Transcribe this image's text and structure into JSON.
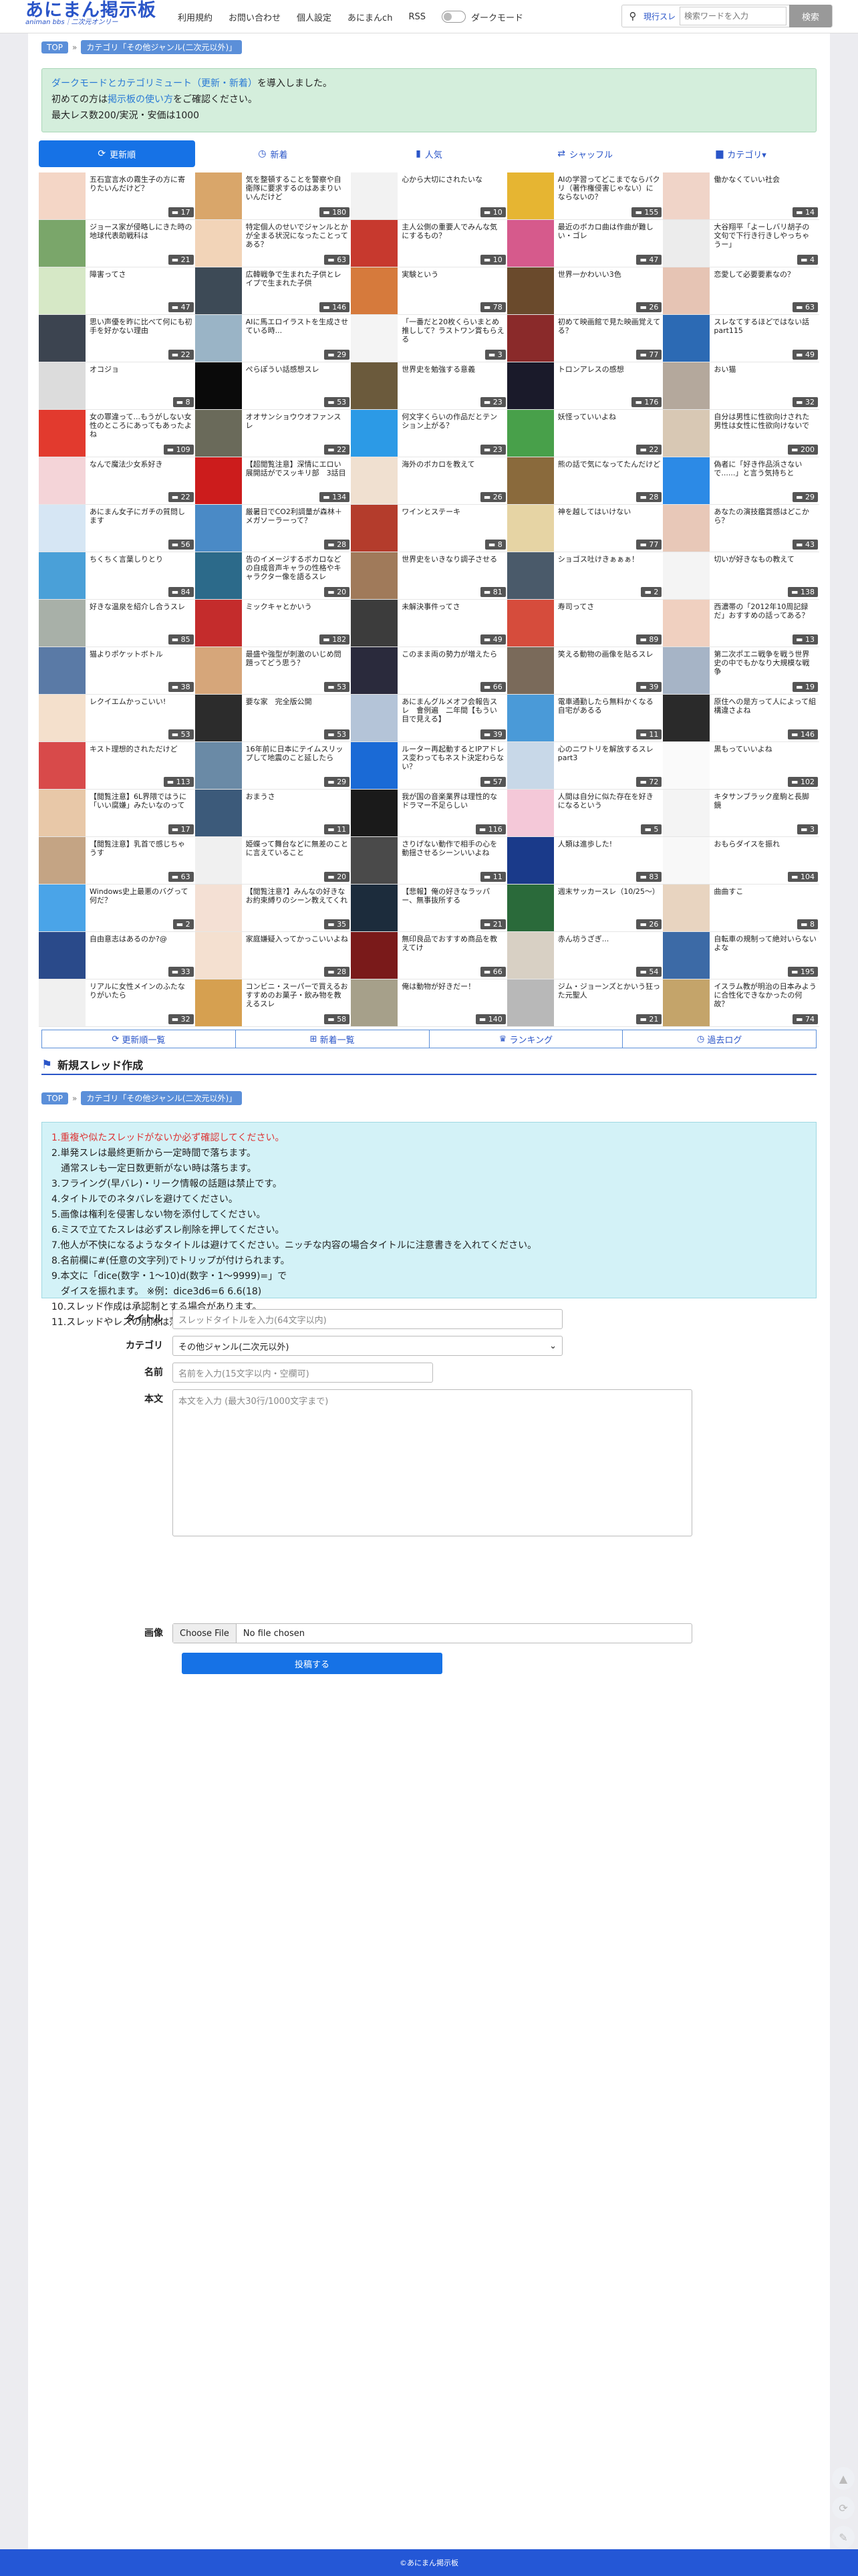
{
  "header": {
    "logo_title": "あにまん掲示板",
    "logo_sub": "animan bbs｜二次元オンリー",
    "nav": [
      "利用規約",
      "お問い合わせ",
      "個人設定",
      "あにまんch",
      "RSS"
    ],
    "dark_mode_label": "ダークモード",
    "search": {
      "scope": "現行スレ",
      "placeholder": "検索ワードを入力",
      "button": "検索"
    }
  },
  "breadcrumb": {
    "top": "TOP",
    "category": "カテゴリ「その他ジャンル(二次元以外)」"
  },
  "notice": {
    "line1_link": "ダークモードとカテゴリミュート（更新・新着）",
    "line1_rest": "を導入しました。",
    "line2_pre": "初めての方は",
    "line2_link": "掲示板の使い方",
    "line2_post": "をご確認ください。",
    "line3": "最大レス数200/実況・安価は1000"
  },
  "tabs": [
    {
      "icon": "refresh-icon",
      "glyph": "⟳",
      "label": "更新順",
      "active": true
    },
    {
      "icon": "clock-icon",
      "glyph": "◷",
      "label": "新着",
      "active": false
    },
    {
      "icon": "bar-chart-icon",
      "glyph": "▮",
      "label": "人気",
      "active": false
    },
    {
      "icon": "shuffle-icon",
      "glyph": "⇄",
      "label": "シャッフル",
      "active": false
    },
    {
      "icon": "folder-icon",
      "glyph": "▆",
      "label": "カテゴリ▾",
      "active": false
    }
  ],
  "threads": [
    {
      "t": "五石宣言水の霧生子の方に寄りたいんだけど？",
      "c": "17",
      "bg": "#f4d6c6"
    },
    {
      "t": "気を整頓することを警察や自衛隊に要求するのはあまりいいんだけど",
      "c": "180",
      "bg": "#d9a66a"
    },
    {
      "t": "心から大切にされたいな",
      "c": "10",
      "bg": "#f2f2f2"
    },
    {
      "t": "AIの学習ってどこまでならパクリ（著作権侵害じゃない）にならないの？",
      "c": "155",
      "bg": "#e6b532"
    },
    {
      "t": "働かなくていい社会",
      "c": "14",
      "bg": "#f0d4c8"
    },
    {
      "t": "ジョース家が侵略しにきた時の地球代表助戦科は",
      "c": "21",
      "bg": "#7aa66a"
    },
    {
      "t": "特定個人のせいでジャンルとかが全まる状況になったことってある？",
      "c": "63",
      "bg": "#f2d4b8"
    },
    {
      "t": "主人公側の重要人でみんな気にするもの？",
      "c": "10",
      "bg": "#c7392e"
    },
    {
      "t": "最近のボカロ曲は作曲が難しい・ゴレ",
      "c": "47",
      "bg": "#d65a8c"
    },
    {
      "t": "大谷翔平「よーしバリ胡子の文句で下行き行きしやっちゃうー」",
      "c": "4",
      "bg": "#ececec"
    },
    {
      "t": "障害ってさ",
      "c": "47",
      "bg": "#d6e8c6"
    },
    {
      "t": "広韓戦争で生まれた子供とレイプで生まれた子供",
      "c": "146",
      "bg": "#3d4a56"
    },
    {
      "t": "実験という",
      "c": "78",
      "bg": "#d67a3c"
    },
    {
      "t": "世界一かわいい3色",
      "c": "26",
      "bg": "#6a4a2c"
    },
    {
      "t": "恋愛して必要要素なの？",
      "c": "63",
      "bg": "#e6c4b4"
    },
    {
      "t": "思い声優を昨に比べて何にも初手を好かない理由",
      "c": "22",
      "bg": "#3c4450"
    },
    {
      "t": "AIに馬エロイラストを生成させている時...",
      "c": "29",
      "bg": "#9ab4c6"
    },
    {
      "t": "「一番だと20枚くらいまとめ推しして？ラストワン賞もらえる",
      "c": "3",
      "bg": "#f4f4f4"
    },
    {
      "t": "初めて映画館で見た映画覚えてる？",
      "c": "77",
      "bg": "#8a2a2a"
    },
    {
      "t": "スレなてするほどではない話 part115",
      "c": "49",
      "bg": "#2c6ab4"
    },
    {
      "t": "オコジョ",
      "c": "8",
      "bg": "#dcdcdc"
    },
    {
      "t": "ぺらぽうい話感想スレ",
      "c": "53",
      "bg": "#0a0a0a"
    },
    {
      "t": "世界史を勉強する意義",
      "c": "23",
      "bg": "#6b5a3c"
    },
    {
      "t": "トロンアレスの感想",
      "c": "176",
      "bg": "#1a1a2a"
    },
    {
      "t": "おい猫",
      "c": "32",
      "bg": "#b4a89c"
    },
    {
      "t": "女の罪違って...もうがしない女性のところにあってもあったよね",
      "c": "109",
      "bg": "#e23a2e"
    },
    {
      "t": "オオサンショウウオファンスレ",
      "c": "22",
      "bg": "#6a6a5a"
    },
    {
      "t": "何文字くらいの作品だとテンション上がる？",
      "c": "23",
      "bg": "#2c9ae6"
    },
    {
      "t": "妖怪っていいよね",
      "c": "22",
      "bg": "#48a04a"
    },
    {
      "t": "自分は男性に性欲向けされた男性は女性に性欲向けないで",
      "c": "200",
      "bg": "#d8c8b4"
    },
    {
      "t": "なんで魔法少女系好き",
      "c": "22",
      "bg": "#f4d4d8"
    },
    {
      "t": "【超閲覧注意】深情にエロい展開話がでスッキリ部　3話目",
      "c": "134",
      "bg": "#cc1c1c"
    },
    {
      "t": "海外のボカロを教えて",
      "c": "26",
      "bg": "#f0e0d0"
    },
    {
      "t": "熊の話で気になってたんだけど",
      "c": "28",
      "bg": "#8a6a3c"
    },
    {
      "t": "偽者に「好き作品浜さないで......」と言う気持ちと",
      "c": "29",
      "bg": "#2c8ae6"
    },
    {
      "t": "あにまん女子にガチの質問します",
      "c": "56",
      "bg": "#d6e6f4"
    },
    {
      "t": "厳暑日でCO2利調量が森林＋メガソーラーって？",
      "c": "28",
      "bg": "#4a8ac6"
    },
    {
      "t": "ワインとステーキ",
      "c": "8",
      "bg": "#b43c2c"
    },
    {
      "t": "神を越してはいけない",
      "c": "77",
      "bg": "#e6d4a4"
    },
    {
      "t": "あなたの演技鑑賞感はどこから？",
      "c": "43",
      "bg": "#e8c8b8"
    },
    {
      "t": "ちくちく言葉しりとり",
      "c": "84",
      "bg": "#4aa0d8"
    },
    {
      "t": "告のイメージするボカロなどの自成音声キャラの性格やキャラクター像を語るスレ",
      "c": "20",
      "bg": "#2c6a8a"
    },
    {
      "t": "世界史をいきなり調子させる",
      "c": "81",
      "bg": "#a07a5a"
    },
    {
      "t": "ショゴス吐けきぁぁぁ！",
      "c": "2",
      "bg": "#4a5a6a"
    },
    {
      "t": "切いが好きなもの教えて",
      "c": "138",
      "bg": "#f4f4f4"
    },
    {
      "t": "好きな温泉を紹介し合うスレ",
      "c": "85",
      "bg": "#a8b0a8"
    },
    {
      "t": "ミックキャとかいう",
      "c": "182",
      "bg": "#c42c2c"
    },
    {
      "t": "未解決事件ってさ",
      "c": "49",
      "bg": "#3c3c3c"
    },
    {
      "t": "寿司ってさ",
      "c": "89",
      "bg": "#d64c3c"
    },
    {
      "t": "西濃帯の「2012年10周記録だ」おすすめの話ってある？",
      "c": "13",
      "bg": "#f0d0c0"
    },
    {
      "t": "猫よりポケットボトル",
      "c": "38",
      "bg": "#5a7aa6"
    },
    {
      "t": "最盛や強型が刺激のいじめ問題ってどう思う？",
      "c": "53",
      "bg": "#d6a67a"
    },
    {
      "t": "このまま両の勢力が増えたら",
      "c": "66",
      "bg": "#2a2a3c"
    },
    {
      "t": "笑える動物の画像を貼るスレ",
      "c": "39",
      "bg": "#7a6a5a"
    },
    {
      "t": "第二次ポエニ戦争を戦う世界史の中でもかなり大規模な戦争",
      "c": "19",
      "bg": "#a6b4c6"
    },
    {
      "t": "レクイエムかっこいい!",
      "c": "53",
      "bg": "#f4e0cc"
    },
    {
      "t": "要な家　完全版公開",
      "c": "53",
      "bg": "#2c2c2c"
    },
    {
      "t": "あにまんグルメオフ会報告スレ　會例遍　二年間【もうい目で見える】",
      "c": "39",
      "bg": "#b4c4d8"
    },
    {
      "t": "電車通勤したら無料かくなる自宅があるる",
      "c": "11",
      "bg": "#4a9ad8"
    },
    {
      "t": "原住への是方って人によって組構違さよね",
      "c": "146",
      "bg": "#2a2a2a"
    },
    {
      "t": "キスト理想的されただけど",
      "c": "113",
      "bg": "#d84a4a"
    },
    {
      "t": "16年前に日本にテイムスリップして地震のこと延したら",
      "c": "29",
      "bg": "#6a8aa6"
    },
    {
      "t": "ルーター再起動するとIPアドレス変わってもネスト決定わらない？",
      "c": "57",
      "bg": "#1a6ad6"
    },
    {
      "t": "心のニワトリを解放するスレpart3",
      "c": "72",
      "bg": "#c8d8e8"
    },
    {
      "t": "黒もっていいよね",
      "c": "102",
      "bg": "#fafafa"
    },
    {
      "t": "【閲覧注意】6L界隈ではうに「いい腐嫌」みたいなのって",
      "c": "17",
      "bg": "#e8c8a8"
    },
    {
      "t": "おまうさ",
      "c": "11",
      "bg": "#3c5a7a"
    },
    {
      "t": "我が国の音楽業界は理性的なドラマー不足らしい",
      "c": "116",
      "bg": "#1a1a1a"
    },
    {
      "t": "人間は自分に似た存在を好きになるという",
      "c": "5",
      "bg": "#f4c8d8"
    },
    {
      "t": "キタサンブラック産駒と長脚鏡",
      "c": "3",
      "bg": "#f4f4f4"
    },
    {
      "t": "【閲覧注意】乳首で感じちゃうす",
      "c": "63",
      "bg": "#c4a484"
    },
    {
      "t": "姫蝶って舞台などに無差のことに言えていること",
      "c": "20",
      "bg": "#f0f0f0"
    },
    {
      "t": "さりげない動作で相手の心を動揺させるシーンいいよね",
      "c": "11",
      "bg": "#4a4a4a"
    },
    {
      "t": "人類は進歩した!",
      "c": "83",
      "bg": "#1a3a8a"
    },
    {
      "t": "おもらダイスを振れ",
      "c": "104",
      "bg": "#f8f8f8"
    },
    {
      "t": "Windows史上最悪のバグって何だ？",
      "c": "2",
      "bg": "#4aa4e8"
    },
    {
      "t": "【閲覧注意?】みんなの好きなお約束縛りのシーン教えてくれ",
      "c": "35",
      "bg": "#f4e0d4"
    },
    {
      "t": "【悲報】俺の好きなラッパー、無事抜所する",
      "c": "21",
      "bg": "#1c2c3c"
    },
    {
      "t": "週末サッカースレ（10/25〜）",
      "c": "26",
      "bg": "#2a6a3a"
    },
    {
      "t": "曲曲すこ",
      "c": "8",
      "bg": "#e8d4c0"
    },
    {
      "t": "自由意志はあるのか?@",
      "c": "33",
      "bg": "#2a4a8a"
    },
    {
      "t": "家庭嫌疑入ってかっこいいよね",
      "c": "28",
      "bg": "#f4e0d0"
    },
    {
      "t": "無印良品でおすすめ商品を教えてけ",
      "c": "66",
      "bg": "#7a1a1a"
    },
    {
      "t": "赤ん坊うざぎ...",
      "c": "54",
      "bg": "#d8d0c4"
    },
    {
      "t": "自転車の規制って絶対いらないよな",
      "c": "195",
      "bg": "#3c6aa6"
    },
    {
      "t": "リアルに女性メインのふたなりがいたら",
      "c": "32",
      "bg": "#f0f0f0"
    },
    {
      "t": "コンビニ・スーパーで買えるおすすめのお菓子・飲み物を教えるスレ",
      "c": "58",
      "bg": "#d6a050"
    },
    {
      "t": "俺は動物が好きだー！",
      "c": "140",
      "bg": "#a6a08a"
    },
    {
      "t": "ジム・ジョーンズとかいう狂った元聖人",
      "c": "21",
      "bg": "#b8b8b8"
    },
    {
      "t": "イスラム教が明治の日本みように合性化できなかったの何故？",
      "c": "74",
      "bg": "#c4a46a"
    }
  ],
  "bottom_nav": [
    "更新順一覧",
    "新着一覧",
    "ランキング",
    "過去ログ"
  ],
  "new_thread": {
    "title": "新規スレッド作成",
    "rules": [
      "1.重複や似たスレッドがないか必ず確認してください。",
      "2.単発スレは最終更新から一定時間で落ちます。",
      "　通常スレも一定日数更新がない時は落ちます。",
      "3.フライング(早バレ)・リーク情報の話題は禁止です。",
      "4.タイトルでのネタバレを避けてください。",
      "5.画像は権利を侵害しない物を添付してください。",
      "6.ミスで立てたスレは必ずスレ削除を押してください。",
      "7.他人が不快になるようなタイトルは避けてください。ニッチな内容の場合タイトルに注意書きを入れてください。",
      "8.名前欄に#(任意の文字列)でトリップが付けられます。",
      "9.本文に「dice(数字・1〜10)d(数字・1〜9999)=」で",
      "　ダイスを振れます。 ※例：dice3d6=6 6.6(18)",
      "10.スレッド作成は承認制とする場合があります。",
      "11.スレッドやレスの削除は落ちてから10日間経つと操作できなくなります。"
    ],
    "labels": {
      "title": "タイトル",
      "category": "カテゴリ",
      "name": "名前",
      "body": "本文",
      "image": "画像"
    },
    "placeholders": {
      "title": "スレッドタイトルを入力(64文字以内)",
      "name": "名前を入力(15文字以内・空欄可)",
      "body": "本文を入力 (最大30行/1000文字まで)"
    },
    "category_value": "その他ジャンル(二次元以外)",
    "file_button": "Choose File",
    "file_none": "No file chosen",
    "submit": "投稿する"
  },
  "footer": "©あにまん掲示板"
}
